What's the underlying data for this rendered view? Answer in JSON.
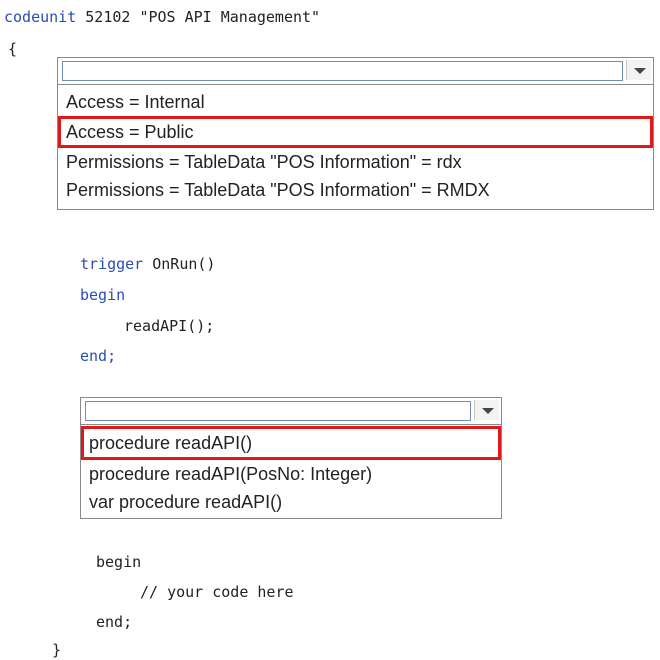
{
  "header": {
    "codeunit_kw": "codeunit",
    "codeunit_rest": "52102 \"POS API Management\"",
    "open_brace": "{"
  },
  "dropdown1": {
    "selected_value": "",
    "options": [
      "Access = Internal",
      "Access = Public",
      "Permissions = TableData \"POS Information\" = rdx",
      "Permissions = TableData \"POS Information\" = RMDX"
    ],
    "highlighted_index": 1
  },
  "trigger": {
    "line1_kw": "trigger",
    "line1_rest": "OnRun()",
    "begin": "begin",
    "call": "readAPI();",
    "end": "end;"
  },
  "dropdown2": {
    "selected_value": "",
    "options": [
      "procedure readAPI()",
      "procedure readAPI(PosNo: Integer)",
      "var procedure readAPI()"
    ],
    "highlighted_index": 0
  },
  "body": {
    "begin": "begin",
    "comment": "// your code here",
    "end": "end;",
    "close_brace": "}"
  },
  "colors": {
    "keyword": "#2a4db3",
    "highlight": "#e01818"
  }
}
